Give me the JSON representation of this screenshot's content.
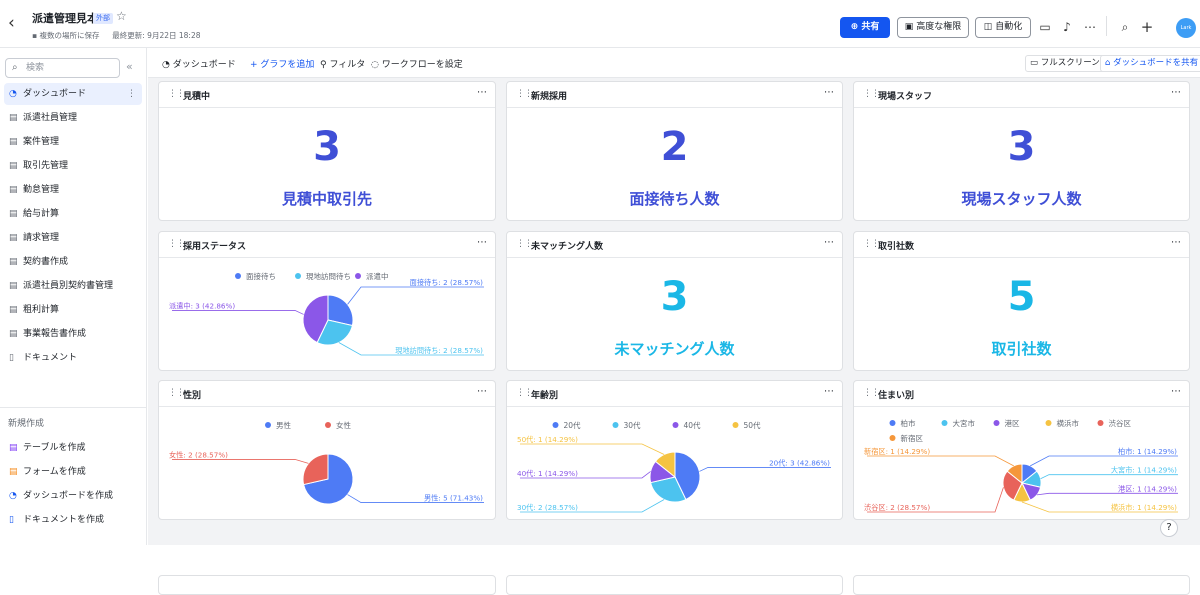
{
  "header": {
    "title": "派遣管理見本",
    "badge": "外部",
    "save_status": "複数の場所に保存",
    "last_updated": "最終更新: 9月22日 18:28",
    "share_label": "共有",
    "permissions_label": "高度な権限",
    "automation_label": "自動化",
    "avatar_text": "Lark"
  },
  "sidebar": {
    "search_placeholder": "検索",
    "items": [
      {
        "label": "ダッシュボード",
        "icon": "dashboard-icon"
      },
      {
        "label": "派遣社員管理",
        "icon": "table-icon"
      },
      {
        "label": "案件管理",
        "icon": "table-icon"
      },
      {
        "label": "取引先管理",
        "icon": "table-icon"
      },
      {
        "label": "勤怠管理",
        "icon": "table-icon"
      },
      {
        "label": "給与計算",
        "icon": "table-icon"
      },
      {
        "label": "請求管理",
        "icon": "table-icon"
      },
      {
        "label": "契約書作成",
        "icon": "table-icon"
      },
      {
        "label": "派遣社員別契約書管理",
        "icon": "table-icon"
      },
      {
        "label": "粗利計算",
        "icon": "table-icon"
      },
      {
        "label": "事業報告書作成",
        "icon": "table-icon"
      },
      {
        "label": "ドキュメント",
        "icon": "doc-icon"
      }
    ],
    "new_heading": "新規作成",
    "new_items": [
      {
        "label": "テーブルを作成",
        "icon": "table-icon",
        "color": "#7f3bf5"
      },
      {
        "label": "フォームを作成",
        "icon": "form-icon",
        "color": "#f58c1f"
      },
      {
        "label": "ダッシュボードを作成",
        "icon": "dashboard-icon",
        "color": "#1456f0"
      },
      {
        "label": "ドキュメントを作成",
        "icon": "doc-icon",
        "color": "#1456f0"
      }
    ]
  },
  "toolbar": {
    "dashboard_label": "ダッシュボード",
    "add_chart": "グラフを追加",
    "filter": "フィルタ",
    "workflow": "ワークフローを設定",
    "fullscreen": "フルスクリーン",
    "share_dashboard": "ダッシュボードを共有"
  },
  "cards": [
    {
      "title": "見積中",
      "value": "3",
      "label": "見積中取引先",
      "color": "#3f4fd6"
    },
    {
      "title": "新規採用",
      "value": "2",
      "label": "面接待ち人数",
      "color": "#3f4fd6"
    },
    {
      "title": "現場スタッフ",
      "value": "3",
      "label": "現場スタッフ人数",
      "color": "#3f4fd6"
    },
    {
      "title": "未マッチング人数",
      "value": "3",
      "label": "未マッチング人数",
      "color": "#1ab7e6"
    },
    {
      "title": "取引社数",
      "value": "5",
      "label": "取引社数",
      "color": "#1ab7e6"
    }
  ],
  "chart_data": [
    {
      "type": "pie",
      "title": "採用ステータス",
      "categories": [
        "面接待ち",
        "現地訪問待ち",
        "派遣中"
      ],
      "values": [
        2,
        2,
        3
      ],
      "colors": [
        "#4e7bf5",
        "#4cc3ef",
        "#8b57e8"
      ],
      "labels": [
        "面接待ち: 2 (28.57%)",
        "現地訪問待ち: 2 (28.57%)",
        "派遣中: 3 (42.86%)"
      ]
    },
    {
      "type": "pie",
      "title": "性別",
      "categories": [
        "男性",
        "女性"
      ],
      "values": [
        5,
        2
      ],
      "colors": [
        "#4e7bf5",
        "#e8635a"
      ],
      "labels": [
        "男性: 5 (71.43%)",
        "女性: 2 (28.57%)"
      ]
    },
    {
      "type": "pie",
      "title": "年齢別",
      "categories": [
        "20代",
        "30代",
        "40代",
        "50代"
      ],
      "values": [
        3,
        2,
        1,
        1
      ],
      "colors": [
        "#4e7bf5",
        "#4cc3ef",
        "#8b57e8",
        "#f5c342"
      ],
      "labels": [
        "20代: 3 (42.86%)",
        "30代: 2 (28.57%)",
        "40代: 1 (14.29%)",
        "50代: 1 (14.29%)"
      ]
    },
    {
      "type": "pie",
      "title": "住まい別",
      "categories": [
        "柏市",
        "大宮市",
        "港区",
        "横浜市",
        "渋谷区",
        "新宿区"
      ],
      "values": [
        1,
        1,
        1,
        1,
        2,
        1
      ],
      "colors": [
        "#4e7bf5",
        "#4cc3ef",
        "#8b57e8",
        "#f5c342",
        "#e8635a",
        "#f5973a"
      ],
      "labels": [
        "柏市: 1 (14.29%)",
        "大宮市: 1 (14.29%)",
        "港区: 1 (14.29%)",
        "横浜市: 1 (14.29%)",
        "渋谷区: 2 (28.57%)",
        "新宿区: 1 (14.29%)"
      ]
    }
  ]
}
